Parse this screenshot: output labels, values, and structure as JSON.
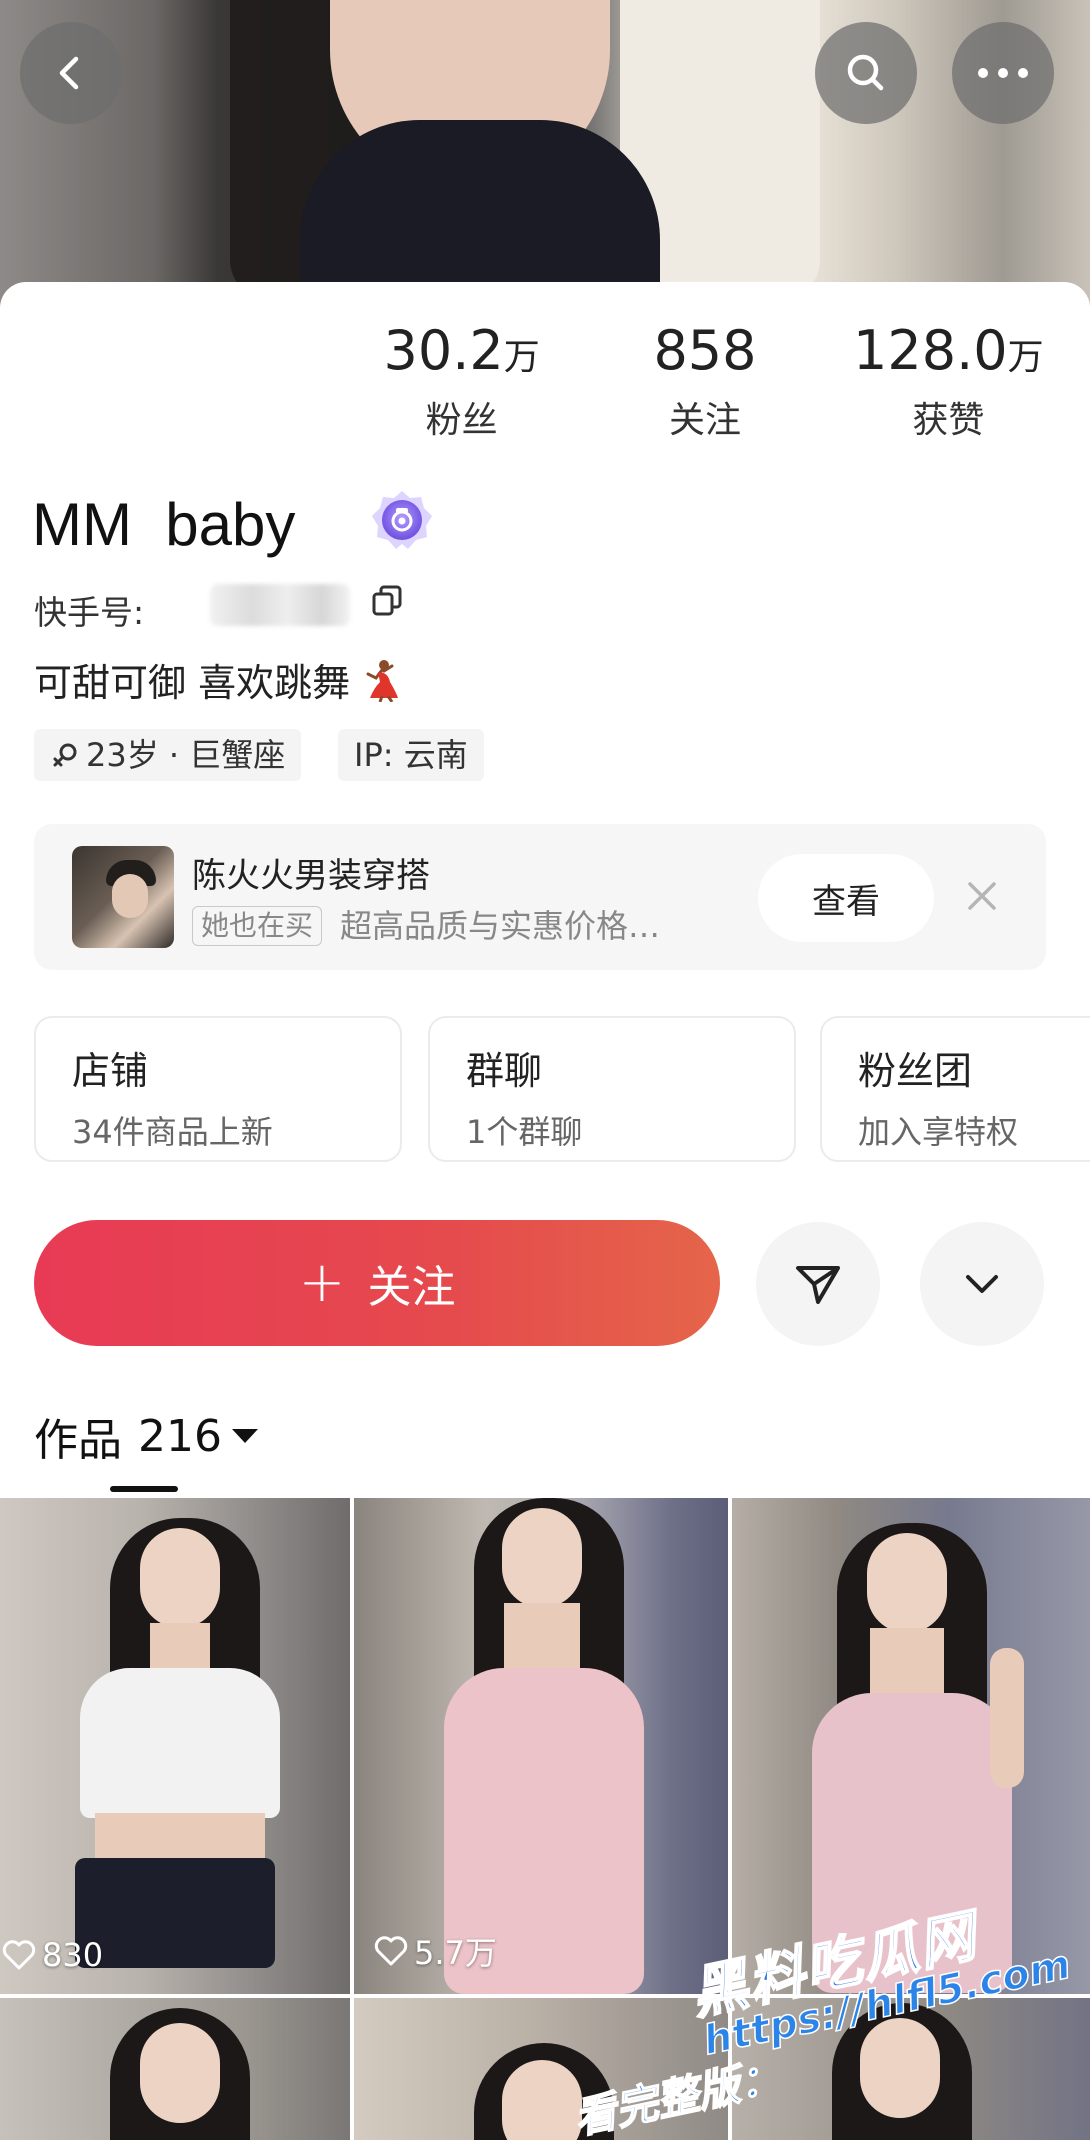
{
  "stats": [
    {
      "value": "30.2",
      "unit": "万",
      "label": "粉丝"
    },
    {
      "value": "858",
      "unit": "",
      "label": "关注"
    },
    {
      "value": "128.0",
      "unit": "万",
      "label": "获赞"
    }
  ],
  "profile": {
    "name": "MM  baby",
    "id_label": "快手号:",
    "bio": "可甜可御 喜欢跳舞",
    "tags": {
      "age": "23岁 · 巨蟹座",
      "ip": "IP:  云南"
    }
  },
  "promo": {
    "title": "陈火火男装穿搭",
    "tag": "她也在买",
    "desc": "超高品质与实惠价格…",
    "view_label": "查看"
  },
  "entries": [
    {
      "title": "店铺",
      "sub": "34件商品上新"
    },
    {
      "title": "群聊",
      "sub": "1个群聊"
    },
    {
      "title": "粉丝团",
      "sub": "加入享特权"
    }
  ],
  "follow": {
    "label": "关注",
    "plus": "+"
  },
  "works": {
    "label": "作品",
    "count": "216"
  },
  "grid": [
    {
      "likes": "830"
    },
    {
      "likes": "5.7万"
    },
    {
      "likes": ""
    }
  ],
  "watermark": {
    "brand": "黑料吃瓜网",
    "url": "https://hlfl5.com",
    "cn": "看完整版："
  },
  "colors": {
    "follow_gradient_start": "#e83a55",
    "follow_gradient_end": "#e5654a",
    "badge_purple": "#8a6ff0",
    "watermark_blue": "#2b84e8"
  },
  "icons": [
    "back-icon",
    "search-icon",
    "more-icon",
    "verified-badge-icon",
    "copy-icon",
    "female-icon",
    "dancer-emoji-icon",
    "close-icon",
    "send-icon",
    "chevron-down-icon",
    "heart-icon"
  ]
}
